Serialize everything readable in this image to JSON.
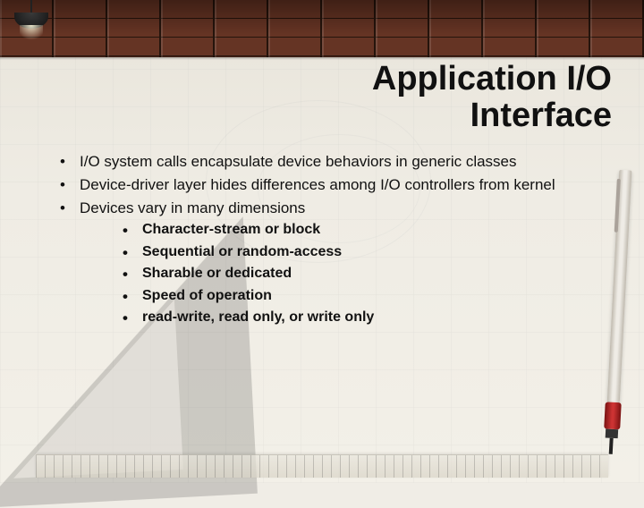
{
  "title_line1": "Application I/O",
  "title_line2": "Interface",
  "bullets": {
    "b0": "I/O system calls encapsulate device behaviors in generic classes",
    "b1": "Device-driver layer hides differences among I/O controllers from kernel",
    "b2": "Devices vary in many dimensions"
  },
  "sub": {
    "s0": "Character-stream or block",
    "s1": "Sequential or random-access",
    "s2": "Sharable or dedicated",
    "s3": "Speed of operation",
    "s4": "read-write, read only, or write only"
  }
}
